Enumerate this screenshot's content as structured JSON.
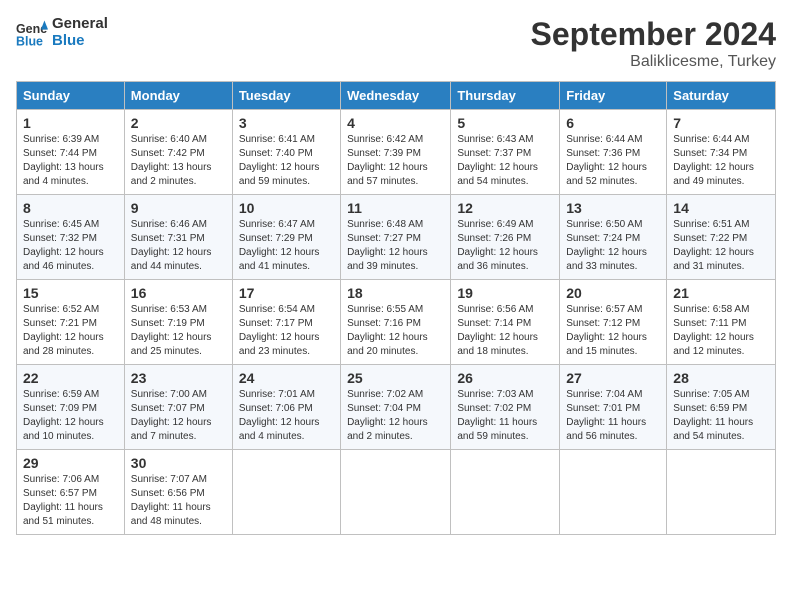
{
  "header": {
    "logo_line1": "General",
    "logo_line2": "Blue",
    "title": "September 2024",
    "subtitle": "Baliklicesme, Turkey"
  },
  "columns": [
    "Sunday",
    "Monday",
    "Tuesday",
    "Wednesday",
    "Thursday",
    "Friday",
    "Saturday"
  ],
  "weeks": [
    [
      {
        "day": "1",
        "info": "Sunrise: 6:39 AM\nSunset: 7:44 PM\nDaylight: 13 hours\nand 4 minutes."
      },
      {
        "day": "2",
        "info": "Sunrise: 6:40 AM\nSunset: 7:42 PM\nDaylight: 13 hours\nand 2 minutes."
      },
      {
        "day": "3",
        "info": "Sunrise: 6:41 AM\nSunset: 7:40 PM\nDaylight: 12 hours\nand 59 minutes."
      },
      {
        "day": "4",
        "info": "Sunrise: 6:42 AM\nSunset: 7:39 PM\nDaylight: 12 hours\nand 57 minutes."
      },
      {
        "day": "5",
        "info": "Sunrise: 6:43 AM\nSunset: 7:37 PM\nDaylight: 12 hours\nand 54 minutes."
      },
      {
        "day": "6",
        "info": "Sunrise: 6:44 AM\nSunset: 7:36 PM\nDaylight: 12 hours\nand 52 minutes."
      },
      {
        "day": "7",
        "info": "Sunrise: 6:44 AM\nSunset: 7:34 PM\nDaylight: 12 hours\nand 49 minutes."
      }
    ],
    [
      {
        "day": "8",
        "info": "Sunrise: 6:45 AM\nSunset: 7:32 PM\nDaylight: 12 hours\nand 46 minutes."
      },
      {
        "day": "9",
        "info": "Sunrise: 6:46 AM\nSunset: 7:31 PM\nDaylight: 12 hours\nand 44 minutes."
      },
      {
        "day": "10",
        "info": "Sunrise: 6:47 AM\nSunset: 7:29 PM\nDaylight: 12 hours\nand 41 minutes."
      },
      {
        "day": "11",
        "info": "Sunrise: 6:48 AM\nSunset: 7:27 PM\nDaylight: 12 hours\nand 39 minutes."
      },
      {
        "day": "12",
        "info": "Sunrise: 6:49 AM\nSunset: 7:26 PM\nDaylight: 12 hours\nand 36 minutes."
      },
      {
        "day": "13",
        "info": "Sunrise: 6:50 AM\nSunset: 7:24 PM\nDaylight: 12 hours\nand 33 minutes."
      },
      {
        "day": "14",
        "info": "Sunrise: 6:51 AM\nSunset: 7:22 PM\nDaylight: 12 hours\nand 31 minutes."
      }
    ],
    [
      {
        "day": "15",
        "info": "Sunrise: 6:52 AM\nSunset: 7:21 PM\nDaylight: 12 hours\nand 28 minutes."
      },
      {
        "day": "16",
        "info": "Sunrise: 6:53 AM\nSunset: 7:19 PM\nDaylight: 12 hours\nand 25 minutes."
      },
      {
        "day": "17",
        "info": "Sunrise: 6:54 AM\nSunset: 7:17 PM\nDaylight: 12 hours\nand 23 minutes."
      },
      {
        "day": "18",
        "info": "Sunrise: 6:55 AM\nSunset: 7:16 PM\nDaylight: 12 hours\nand 20 minutes."
      },
      {
        "day": "19",
        "info": "Sunrise: 6:56 AM\nSunset: 7:14 PM\nDaylight: 12 hours\nand 18 minutes."
      },
      {
        "day": "20",
        "info": "Sunrise: 6:57 AM\nSunset: 7:12 PM\nDaylight: 12 hours\nand 15 minutes."
      },
      {
        "day": "21",
        "info": "Sunrise: 6:58 AM\nSunset: 7:11 PM\nDaylight: 12 hours\nand 12 minutes."
      }
    ],
    [
      {
        "day": "22",
        "info": "Sunrise: 6:59 AM\nSunset: 7:09 PM\nDaylight: 12 hours\nand 10 minutes."
      },
      {
        "day": "23",
        "info": "Sunrise: 7:00 AM\nSunset: 7:07 PM\nDaylight: 12 hours\nand 7 minutes."
      },
      {
        "day": "24",
        "info": "Sunrise: 7:01 AM\nSunset: 7:06 PM\nDaylight: 12 hours\nand 4 minutes."
      },
      {
        "day": "25",
        "info": "Sunrise: 7:02 AM\nSunset: 7:04 PM\nDaylight: 12 hours\nand 2 minutes."
      },
      {
        "day": "26",
        "info": "Sunrise: 7:03 AM\nSunset: 7:02 PM\nDaylight: 11 hours\nand 59 minutes."
      },
      {
        "day": "27",
        "info": "Sunrise: 7:04 AM\nSunset: 7:01 PM\nDaylight: 11 hours\nand 56 minutes."
      },
      {
        "day": "28",
        "info": "Sunrise: 7:05 AM\nSunset: 6:59 PM\nDaylight: 11 hours\nand 54 minutes."
      }
    ],
    [
      {
        "day": "29",
        "info": "Sunrise: 7:06 AM\nSunset: 6:57 PM\nDaylight: 11 hours\nand 51 minutes."
      },
      {
        "day": "30",
        "info": "Sunrise: 7:07 AM\nSunset: 6:56 PM\nDaylight: 11 hours\nand 48 minutes."
      },
      {
        "day": "",
        "info": ""
      },
      {
        "day": "",
        "info": ""
      },
      {
        "day": "",
        "info": ""
      },
      {
        "day": "",
        "info": ""
      },
      {
        "day": "",
        "info": ""
      }
    ]
  ]
}
